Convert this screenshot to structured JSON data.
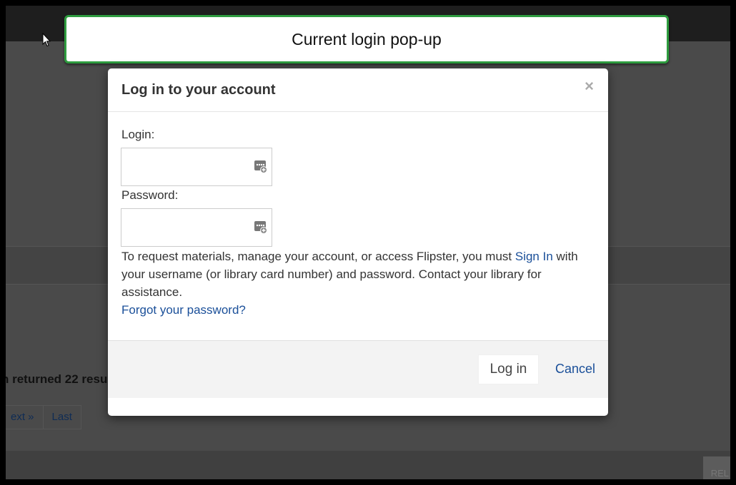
{
  "background": {
    "results_text": "h returned 22 resu",
    "pager": [
      "ext »",
      "Last"
    ],
    "corner_tab": "REL"
  },
  "callout": {
    "text": "Current login pop-up",
    "border_color": "#2e9c3f"
  },
  "modal": {
    "title": "Log in to your account",
    "close_symbol": "×",
    "login_label": "Login:",
    "login_value": "",
    "password_label": "Password:",
    "password_value": "",
    "field_icon": "password-manager-icon",
    "help_text_1": "To request materials, manage your account, or access Flipster, you must ",
    "sign_in_link": "Sign In",
    "help_text_2": " with your username (or library card number) and password. Contact your library for assistance.",
    "forgot_link": "Forgot your password?",
    "login_button": "Log in",
    "cancel_link": "Cancel",
    "link_color": "#1a4f99"
  }
}
